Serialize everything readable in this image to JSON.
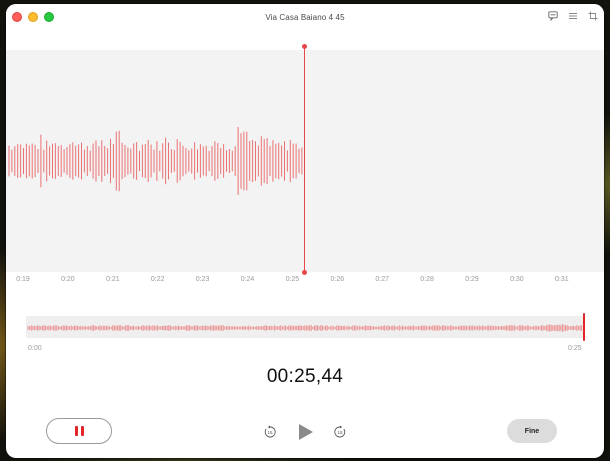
{
  "window": {
    "title": "Via Casa Baiano 4 45"
  },
  "toolbar_icons": [
    "speech-bubble-icon",
    "list-icon",
    "crop-icon"
  ],
  "waveform": {
    "timeline_labels": [
      "0:19",
      "0:20",
      "0:21",
      "0:22",
      "0:23",
      "0:24",
      "0:25",
      "0:26",
      "0:27",
      "0:28",
      "0:29",
      "0:30",
      "0:31"
    ],
    "color": "#e8474a",
    "background": "#f3f3f3"
  },
  "overview": {
    "start_label": "0:00",
    "end_label": "0:25",
    "progress": 1.0,
    "color": "#e8474a"
  },
  "timer": "00:25,44",
  "controls": {
    "pause_icon": "pause-icon",
    "skip_back_label": "15",
    "skip_forward_label": "15",
    "done_label": "Fine"
  },
  "colors": {
    "accent": "#e3252a"
  }
}
